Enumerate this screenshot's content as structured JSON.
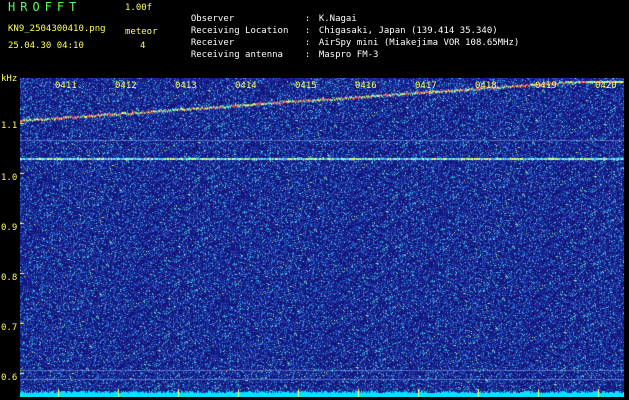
{
  "header": {
    "logo": "HROFFT",
    "version": "1.00f",
    "filename": "KN9_2504300410.png",
    "meteor_label": "meteor",
    "meteor_count": "4",
    "datetime": "25.04.30 04:10"
  },
  "metadata": [
    {
      "key": "Observer",
      "value": "K.Nagai"
    },
    {
      "key": "Receiving Location",
      "value": "Chigasaki, Japan (139.414 35.340)"
    },
    {
      "key": "Receiver",
      "value": "AirSpy mini (Miakejima VOR 108.65MHz)"
    },
    {
      "key": "Receiving antenna",
      "value": "Maspro FM-3"
    }
  ],
  "axis": {
    "unit": "kHz",
    "ticks": [
      "1.1",
      "1.0",
      "0.9",
      "0.8",
      "0.7",
      "0.6"
    ]
  },
  "time_labels": [
    "0411",
    "0412",
    "0413",
    "0414",
    "0415",
    "0416",
    "0417",
    "0418",
    "0419",
    "0420"
  ],
  "colors": {
    "background": "#1a1a8a",
    "label_yellow": "#ffff55",
    "logo_green": "#55ff55",
    "baseline_cyan": "#00e5ff"
  }
}
